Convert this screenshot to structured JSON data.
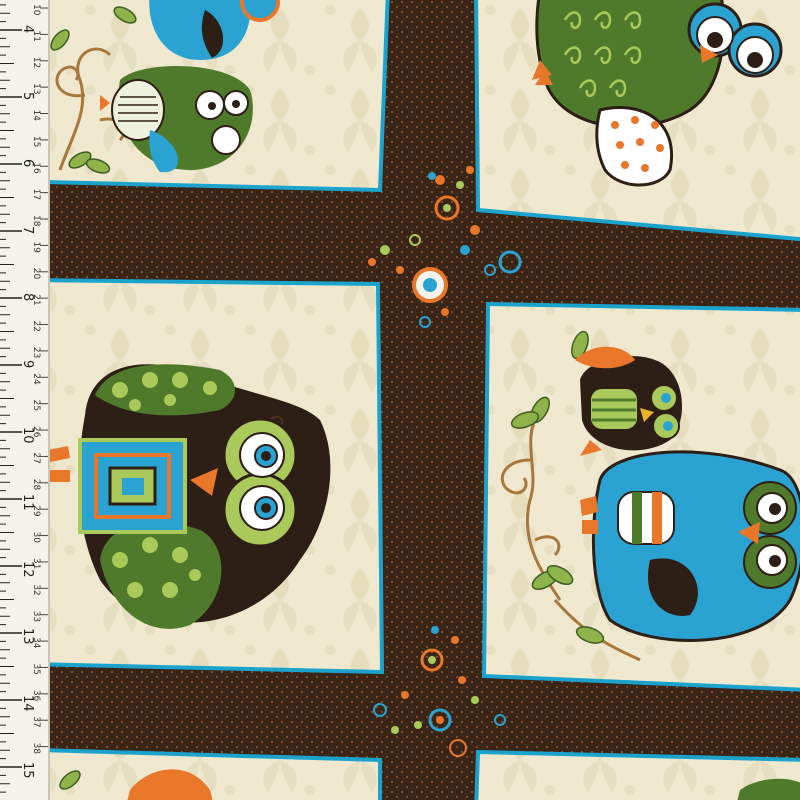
{
  "image": {
    "subject": "owl-print-fabric-with-measuring-tape",
    "colors": {
      "sashing": "#3a2519",
      "sashing_dot": "#a0582a",
      "panel_cream": "#efe8cf",
      "panel_damask": "#e3dab8",
      "panel_border": "#1aa3cc",
      "owl_green": "#4f7a2b",
      "owl_lime": "#a9c95a",
      "owl_blue": "#2aa3d3",
      "owl_brown": "#2e1f16",
      "owl_orange": "#e9772a",
      "branch_tan": "#a8773c",
      "tape_white": "#f4f2ec"
    }
  },
  "ruler": {
    "inch_labels": [
      "4",
      "5",
      "6",
      "7",
      "8",
      "9",
      "10",
      "11",
      "12",
      "13",
      "14",
      "15"
    ],
    "cm_labels": [
      "10",
      "11",
      "12",
      "13",
      "14",
      "15",
      "16",
      "17",
      "18",
      "19",
      "20",
      "21",
      "22",
      "23",
      "24",
      "25",
      "26",
      "27",
      "28",
      "29",
      "30",
      "31",
      "32",
      "33",
      "34",
      "35",
      "36",
      "37",
      "38"
    ]
  }
}
